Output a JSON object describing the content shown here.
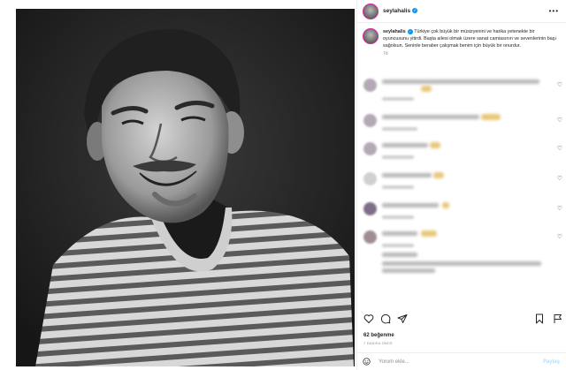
{
  "post": {
    "username": "seylahalis",
    "caption_username": "seylahalis",
    "caption": "Türkiye çok büyük bir müsizyenini ve harika yetenekte bir oyuncusunu yitirdi. Başta ailesi olmak üzere sanat camiasının ve sevenlerinin başı sağolsun. Seninle beraber çalışmak benim için büyük bir onurdur.",
    "time": "7d",
    "likes": "62 beğenme",
    "posted_ago": "7 DAKİKA ÖNCE"
  },
  "add_comment": {
    "placeholder": "Yorum ekle...",
    "post_label": "Paylaş"
  },
  "icons": {
    "more": "more-dots-icon",
    "verified": "verified-badge-icon",
    "like": "heart-icon",
    "comment": "comment-icon",
    "share": "share-icon",
    "save": "bookmark-icon",
    "emoji": "emoji-icon"
  },
  "colors": {
    "story_ring": "#d6249f",
    "verified": "#0095f6",
    "muted_text": "#8e8e8e"
  }
}
